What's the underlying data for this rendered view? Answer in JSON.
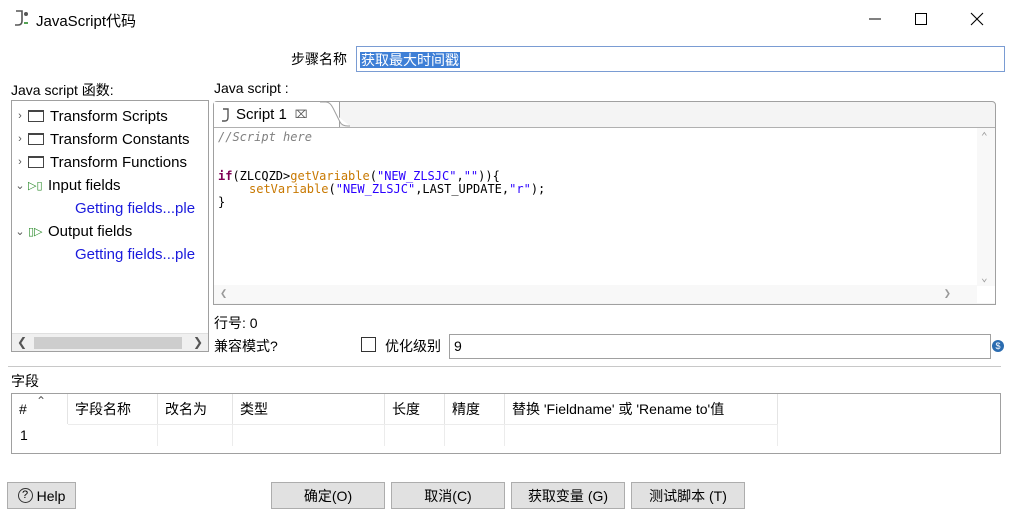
{
  "window": {
    "title": "JavaScript代码"
  },
  "step": {
    "label": "步骤名称",
    "value": "获取最大时间戳"
  },
  "left_panel": {
    "label": "Java script 函数:",
    "tree": [
      {
        "label": "Transform Scripts",
        "type": "folder",
        "expanded": false
      },
      {
        "label": "Transform Constants",
        "type": "folder",
        "expanded": false
      },
      {
        "label": "Transform Functions",
        "type": "folder",
        "expanded": false
      },
      {
        "label": "Input fields",
        "type": "input-fields",
        "expanded": true,
        "child": "Getting fields...ple"
      },
      {
        "label": "Output fields",
        "type": "output-fields",
        "expanded": true,
        "child": "Getting fields...ple"
      }
    ]
  },
  "script": {
    "label": "Java script :",
    "tab_label": "Script 1",
    "code": {
      "line1": "//Script here",
      "line3_kw": "if",
      "line3_a": "(ZLCQZD>",
      "line3_fn": "getVariable",
      "line3_b": "(",
      "line3_str1": "\"NEW_ZLSJC\"",
      "line3_c": ",",
      "line3_str2": "\"\"",
      "line3_d": ")){",
      "line4_fn": "setVariable",
      "line4_a": "(",
      "line4_str1": "\"NEW_ZLSJC\"",
      "line4_b": ",LAST_UPDATE,",
      "line4_str2": "\"r\"",
      "line4_c": ");",
      "line5": "}"
    }
  },
  "status": {
    "line_no": "行号: 0",
    "compat_label": "兼容模式?",
    "optimize_label": "优化级别",
    "optimize_value": "9"
  },
  "fields": {
    "label": "字段",
    "columns": [
      "#",
      "字段名称",
      "改名为",
      "类型",
      "长度",
      "精度",
      "替换 'Fieldname' 或 'Rename to'值"
    ],
    "rows": [
      {
        "num": "1"
      }
    ]
  },
  "buttons": {
    "help": "Help",
    "ok": "确定(O)",
    "cancel": "取消(C)",
    "get_vars": "获取变量 (G)",
    "test": "测试脚本 (T)"
  }
}
